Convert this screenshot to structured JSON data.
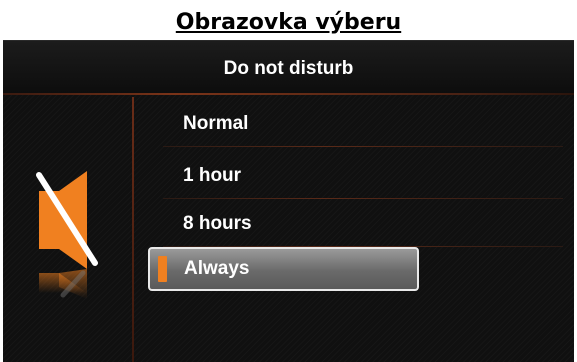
{
  "caption": "Obrazovka výberu",
  "header": {
    "title": "Do not disturb"
  },
  "icon": {
    "name": "speaker-mute-icon",
    "color": "#f08020"
  },
  "menu": {
    "items": [
      {
        "label": "Normal",
        "selected": false
      },
      {
        "label": "1 hour",
        "selected": false
      },
      {
        "label": "8 hours",
        "selected": false
      },
      {
        "label": "Always",
        "selected": true
      }
    ]
  },
  "colors": {
    "accent": "#f08020",
    "background": "#101010",
    "selection": "#7a7a7a"
  }
}
